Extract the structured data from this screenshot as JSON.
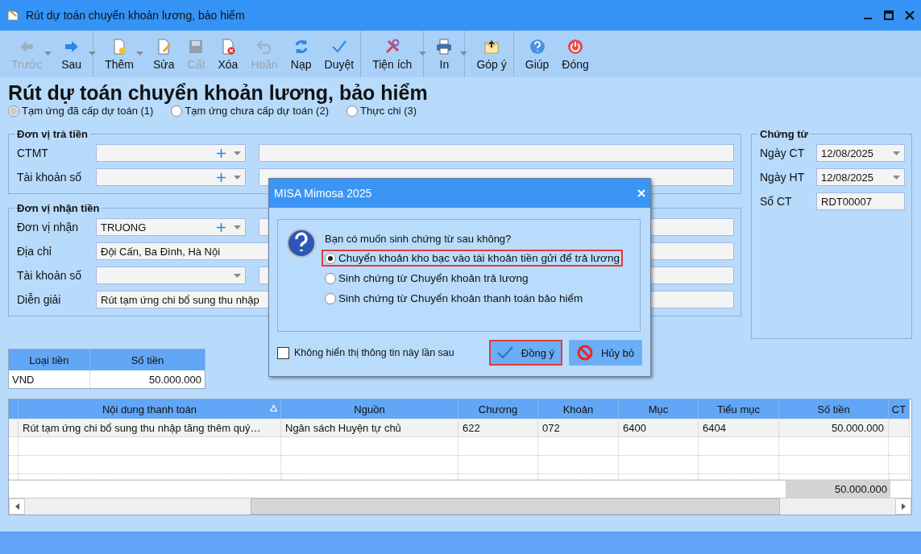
{
  "window": {
    "title": "Rút dự toán chuyển khoản lương, bảo hiểm"
  },
  "toolbar": [
    {
      "label": "Trước",
      "disabled": true,
      "dropdown": true,
      "separator_after": false
    },
    {
      "label": "Sau",
      "disabled": false,
      "dropdown": true,
      "separator_after": true
    },
    {
      "label": "Thêm",
      "disabled": false,
      "dropdown": true,
      "separator_after": false
    },
    {
      "label": "Sửa",
      "disabled": false,
      "dropdown": false,
      "separator_after": false
    },
    {
      "label": "Cất",
      "disabled": true,
      "dropdown": false,
      "separator_after": false
    },
    {
      "label": "Xóa",
      "disabled": false,
      "dropdown": false,
      "separator_after": false
    },
    {
      "label": "Hoãn",
      "disabled": true,
      "dropdown": false,
      "separator_after": false
    },
    {
      "label": "Nạp",
      "disabled": false,
      "dropdown": false,
      "separator_after": false
    },
    {
      "label": "Duyệt",
      "disabled": false,
      "dropdown": false,
      "separator_after": true
    },
    {
      "label": "Tiện ích",
      "disabled": false,
      "dropdown": true,
      "separator_after": true
    },
    {
      "label": "In",
      "disabled": false,
      "dropdown": true,
      "separator_after": true
    },
    {
      "label": "Góp ý",
      "disabled": false,
      "dropdown": false,
      "separator_after": true
    },
    {
      "label": "Giúp",
      "disabled": false,
      "dropdown": false,
      "separator_after": false
    },
    {
      "label": "Đóng",
      "disabled": false,
      "dropdown": false,
      "separator_after": false
    }
  ],
  "heading": "Rút dự toán chuyển khoản lương, bảo hiểm",
  "modes": [
    {
      "label": "Tạm ứng đã cấp dự toán (1)",
      "selected": true
    },
    {
      "label": "Tạm ứng chưa cấp dự toán (2)",
      "selected": false
    },
    {
      "label": "Thực chi (3)",
      "selected": false
    }
  ],
  "payer": {
    "title": "Đơn vị trả tiền",
    "rows": [
      {
        "label": "CTMT",
        "kind": "lookup"
      },
      {
        "label": "Tài khoản số",
        "kind": "lookup"
      }
    ]
  },
  "payee": {
    "title": "Đơn vị nhận tiền",
    "rows": [
      {
        "label": "Đơn vị nhận",
        "kind": "lookup",
        "value": "TRUONG"
      },
      {
        "label": "Địa chỉ",
        "kind": "text",
        "value": "Đội Cấn, Ba Đình, Hà Nội"
      },
      {
        "label": "Tài khoản số",
        "kind": "select"
      },
      {
        "label": "Diễn giải",
        "kind": "text",
        "value": "Rút tạm ứng chi bổ sung thu nhập"
      }
    ]
  },
  "voucher": {
    "title": "Chứng từ",
    "rows": [
      {
        "label": "Ngày CT",
        "kind": "date",
        "value": "12/08/2025"
      },
      {
        "label": "Ngày HT",
        "kind": "date",
        "value": "12/08/2025"
      },
      {
        "label": "Số CT",
        "kind": "readonly",
        "value": "RDT00007"
      }
    ]
  },
  "currency_table": {
    "columns": [
      "Loại tiền",
      "Số tiền"
    ],
    "rows": [
      [
        "VND",
        "50.000.000"
      ]
    ]
  },
  "grid": {
    "columns": [
      {
        "label": "Nội dung thanh toán",
        "sorted": true
      },
      {
        "label": "Nguồn",
        "sorted": false
      },
      {
        "label": "Chương",
        "sorted": false
      },
      {
        "label": "Khoản",
        "sorted": false
      },
      {
        "label": "Mục",
        "sorted": false
      },
      {
        "label": "Tiểu mục",
        "sorted": false
      },
      {
        "label": "Số tiền",
        "sorted": false
      },
      {
        "label": "CT",
        "sorted": false
      }
    ],
    "rows": [
      [
        "Rút tạm ứng chi bổ sung thu nhập tăng thêm quý…",
        "Ngân sách Huyện tự chủ",
        "622",
        "072",
        "6400",
        "6404",
        "50.000.000"
      ]
    ],
    "total": "50.000.000"
  },
  "dialog": {
    "title": "MISA Mimosa 2025",
    "question": "Bạn có muốn sinh chứng từ sau không?",
    "options": [
      {
        "label": "Chuyển khoản kho bạc vào tài khoản tiền gửi để trả lương",
        "selected": true,
        "highlighted": true
      },
      {
        "label": "Sinh chứng từ Chuyển khoản trả lương",
        "selected": false,
        "highlighted": false
      },
      {
        "label": "Sinh chứng từ Chuyển khoản thanh toán bảo hiểm",
        "selected": false,
        "highlighted": false
      }
    ],
    "checkbox": {
      "label": "Không hiển thị thông tin này lần sau",
      "checked": false
    },
    "buttons": [
      {
        "label": "Đồng ý",
        "kind": "ok",
        "highlighted": true
      },
      {
        "label": "Hủy bỏ",
        "kind": "cancel",
        "highlighted": false
      }
    ]
  }
}
